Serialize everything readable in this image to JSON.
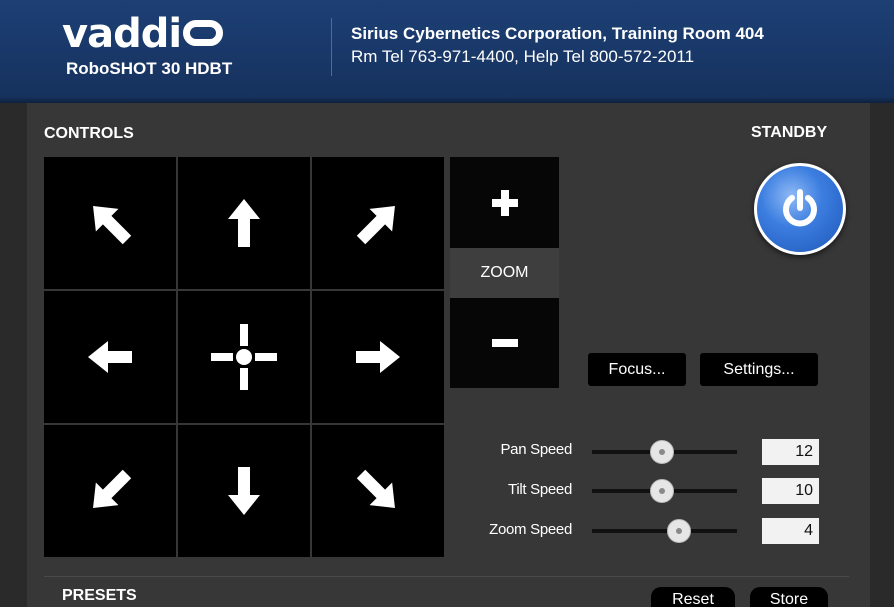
{
  "header": {
    "brand": "vaddi",
    "model": "RoboSHOT 30 HDBT",
    "room": "Sirius Cybernetics Corporation, Training Room 404",
    "phones": "Rm Tel 763-971-4400, Help Tel 800-572-2011"
  },
  "controls": {
    "section_label": "CONTROLS",
    "standby_label": "STANDBY",
    "dpad": {
      "up_left": "arrow-up-left-icon",
      "up": "arrow-up-icon",
      "up_right": "arrow-up-right-icon",
      "left": "arrow-left-icon",
      "home": "home-crosshair-icon",
      "right": "arrow-right-icon",
      "down_left": "arrow-down-left-icon",
      "down": "arrow-down-icon",
      "down_right": "arrow-down-right-icon"
    },
    "zoom_label": "ZOOM",
    "zoom_in_symbol": "+",
    "zoom_out_symbol": "−",
    "focus_button": "Focus...",
    "settings_button": "Settings...",
    "sliders": [
      {
        "label": "Pan Speed",
        "value": "12",
        "level": 0.48
      },
      {
        "label": "Tilt Speed",
        "value": "10",
        "level": 0.48
      },
      {
        "label": "Zoom Speed",
        "value": "4",
        "level": 0.6
      }
    ]
  },
  "presets": {
    "section_label": "PRESETS",
    "reset_button": "Reset",
    "store_button": "Store"
  },
  "colors": {
    "header_blue": "#1a3a6c",
    "panel": "#373737",
    "standby_blue": "#3c7ee0"
  }
}
